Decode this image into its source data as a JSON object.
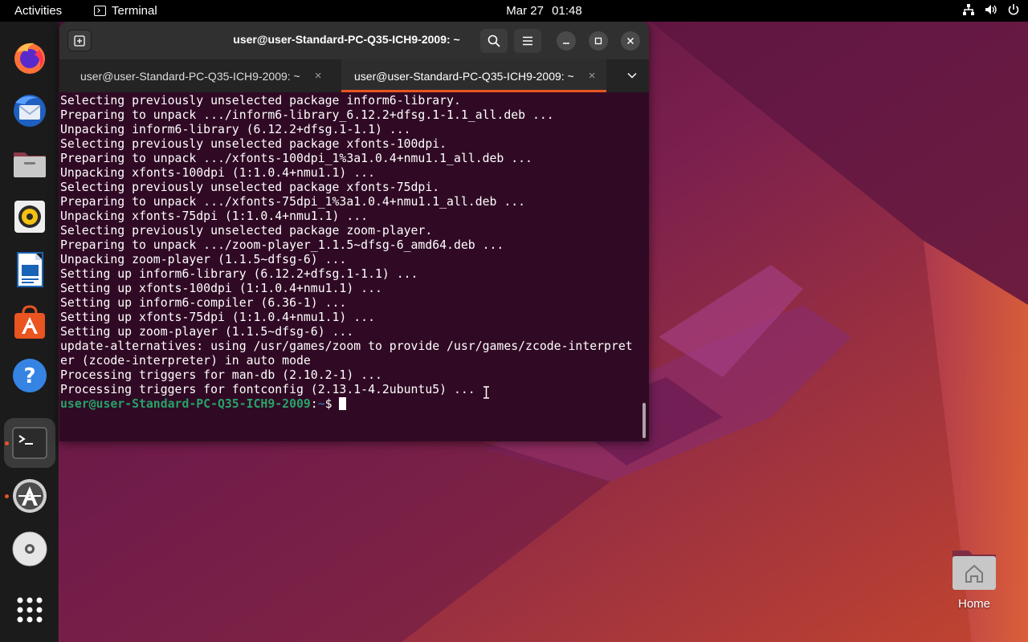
{
  "topbar": {
    "activities": "Activities",
    "app_name": "Terminal",
    "date": "Mar 27",
    "time": "01:48"
  },
  "dock": {
    "items": [
      "firefox-icon",
      "thunderbird-icon",
      "files-icon",
      "rhythmbox-icon",
      "libreoffice-writer-icon",
      "ubuntu-software-icon",
      "help-icon",
      "terminal-icon",
      "software-updater-icon",
      "disc-icon",
      "app-grid-icon"
    ],
    "running": [
      "terminal-icon",
      "software-updater-icon"
    ],
    "accent": "#e95420"
  },
  "desktop": {
    "home_label": "Home"
  },
  "terminal": {
    "title": "user@user-Standard-PC-Q35-ICH9-2009: ~",
    "tabs": [
      {
        "label": "user@user-Standard-PC-Q35-ICH9-2009: ~",
        "close": "×"
      },
      {
        "label": "user@user-Standard-PC-Q35-ICH9-2009: ~",
        "close": "×"
      }
    ],
    "output_lines": [
      "Selecting previously unselected package inform6-library.",
      "Preparing to unpack .../inform6-library_6.12.2+dfsg.1-1.1_all.deb ...",
      "Unpacking inform6-library (6.12.2+dfsg.1-1.1) ...",
      "Selecting previously unselected package xfonts-100dpi.",
      "Preparing to unpack .../xfonts-100dpi_1%3a1.0.4+nmu1.1_all.deb ...",
      "Unpacking xfonts-100dpi (1:1.0.4+nmu1.1) ...",
      "Selecting previously unselected package xfonts-75dpi.",
      "Preparing to unpack .../xfonts-75dpi_1%3a1.0.4+nmu1.1_all.deb ...",
      "Unpacking xfonts-75dpi (1:1.0.4+nmu1.1) ...",
      "Selecting previously unselected package zoom-player.",
      "Preparing to unpack .../zoom-player_1.1.5~dfsg-6_amd64.deb ...",
      "Unpacking zoom-player (1.1.5~dfsg-6) ...",
      "Setting up inform6-library (6.12.2+dfsg.1-1.1) ...",
      "Setting up xfonts-100dpi (1:1.0.4+nmu1.1) ...",
      "Setting up inform6-compiler (6.36-1) ...",
      "Setting up xfonts-75dpi (1:1.0.4+nmu1.1) ...",
      "Setting up zoom-player (1.1.5~dfsg-6) ...",
      "update-alternatives: using /usr/games/zoom to provide /usr/games/zcode-interpret",
      "er (zcode-interpreter) in auto mode",
      "Processing triggers for man-db (2.10.2-1) ...",
      "Processing triggers for fontconfig (2.13.1-4.2ubuntu5) ..."
    ],
    "prompt_user": "user@user-Standard-PC-Q35-ICH9-2009",
    "prompt_sep": ":",
    "prompt_path": "~",
    "prompt_symbol": "$"
  }
}
